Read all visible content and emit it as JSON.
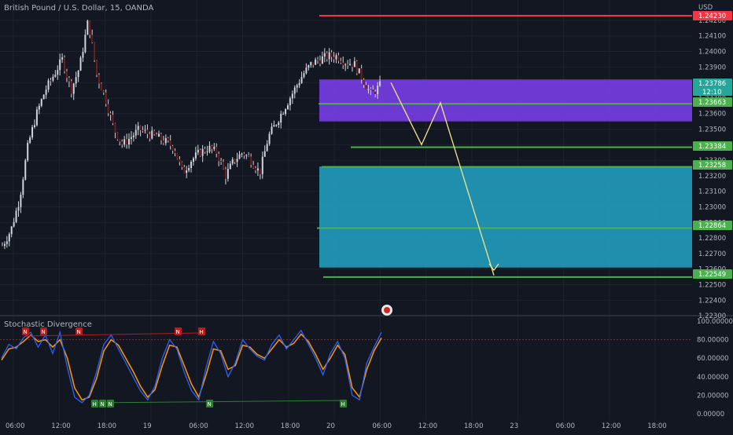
{
  "header": {
    "title": "British Pound / U.S. Dollar, 15, OANDA"
  },
  "indicator": {
    "title": "Stochastic Divergence"
  },
  "chart_data": [
    {
      "type": "candlestick",
      "currency": "USD",
      "y_ticks": [
        "1.24200",
        "1.24100",
        "1.24000",
        "1.23900",
        "1.23800",
        "1.23700",
        "1.23600",
        "1.23500",
        "1.23400",
        "1.23300",
        "1.23200",
        "1.23100",
        "1.23000",
        "1.22900",
        "1.22800",
        "1.22700",
        "1.22600",
        "1.22500",
        "1.22400",
        "1.22300"
      ],
      "x_ticks": [
        "06:00",
        "12:00",
        "18:00",
        "19",
        "06:00",
        "12:00",
        "18:00",
        "20",
        "06:00",
        "12:00",
        "18:00",
        "23",
        "06:00",
        "12:00",
        "18:00"
      ],
      "price_labels": [
        {
          "value": "1.24230",
          "color": "#f23645"
        },
        {
          "value": "1.23786",
          "sub": "12:10",
          "color": "#26a69a"
        },
        {
          "value": "1.23663",
          "color": "#4caf50"
        },
        {
          "value": "1.23384",
          "color": "#4caf50"
        },
        {
          "value": "1.23258",
          "color": "#4caf50"
        },
        {
          "value": "1.22864",
          "color": "#4caf50"
        },
        {
          "value": "1.22549",
          "color": "#4caf50"
        }
      ],
      "zones": [
        {
          "name": "supply-zone",
          "from": 1.2355,
          "to": 1.2382,
          "color": "#7e3ff2"
        },
        {
          "name": "demand-zone",
          "from": 1.2261,
          "to": 1.2326,
          "color": "#22a5c5"
        }
      ],
      "levels": [
        {
          "value": 1.2423,
          "color": "#f23645"
        },
        {
          "value": 1.23663,
          "color": "#4caf50"
        },
        {
          "value": 1.23384,
          "color": "#4caf50"
        },
        {
          "value": 1.23258,
          "color": "#4caf50"
        },
        {
          "value": 1.22864,
          "color": "#4caf50"
        },
        {
          "value": 1.22549,
          "color": "#4caf50"
        }
      ],
      "close_path": [
        1.2275,
        1.2285,
        1.2305,
        1.234,
        1.236,
        1.2375,
        1.2385,
        1.2395,
        1.2375,
        1.239,
        1.242,
        1.2385,
        1.237,
        1.235,
        1.234,
        1.2345,
        1.235,
        1.2347,
        1.2345,
        1.2342,
        1.2338,
        1.2322,
        1.233,
        1.2335,
        1.2338,
        1.2335,
        1.232,
        1.233,
        1.2335,
        1.233,
        1.2322,
        1.2345,
        1.2355,
        1.2365,
        1.2375,
        1.2385,
        1.2392,
        1.2395,
        1.2397,
        1.2397,
        1.2393,
        1.2392,
        1.2382,
        1.2372,
        1.2378
      ],
      "projection": [
        1.238,
        1.234,
        1.2367,
        1.2256
      ]
    },
    {
      "type": "line",
      "name": "Stochastic Divergence",
      "y_ticks": [
        "100.00000",
        "80.00000",
        "60.00000",
        "40.00000",
        "20.00000",
        "0.00000"
      ],
      "ylim": [
        0,
        100
      ],
      "reference_level": 80,
      "markers_top": [
        "N",
        "N",
        "N",
        "N",
        "H",
        "H"
      ],
      "markers_bottom": [
        "H",
        "N",
        "N",
        "N",
        "H"
      ],
      "k": [
        60,
        75,
        70,
        82,
        88,
        72,
        85,
        65,
        88,
        50,
        18,
        12,
        20,
        45,
        75,
        85,
        70,
        55,
        40,
        25,
        15,
        30,
        60,
        80,
        70,
        45,
        25,
        15,
        50,
        78,
        65,
        40,
        55,
        80,
        70,
        62,
        58,
        75,
        85,
        70,
        80,
        90,
        75,
        60,
        42,
        65,
        78,
        60,
        20,
        15,
        55,
        72,
        88
      ],
      "d": [
        58,
        70,
        72,
        78,
        85,
        78,
        80,
        72,
        80,
        60,
        28,
        15,
        18,
        38,
        68,
        80,
        74,
        60,
        46,
        30,
        18,
        26,
        52,
        74,
        72,
        52,
        32,
        18,
        42,
        70,
        68,
        48,
        52,
        74,
        72,
        64,
        60,
        70,
        80,
        72,
        76,
        86,
        78,
        64,
        48,
        60,
        74,
        64,
        28,
        18,
        48,
        68,
        82
      ]
    }
  ]
}
